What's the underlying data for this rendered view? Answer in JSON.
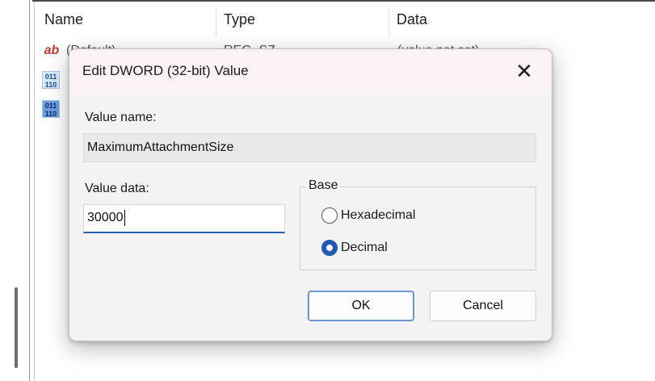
{
  "list": {
    "columns": [
      {
        "label": "Name"
      },
      {
        "label": "Type"
      },
      {
        "label": "Data"
      }
    ],
    "rows": [
      {
        "icon": "string-value-icon",
        "name": "(Default)",
        "type": "REG_SZ",
        "data": "(value not set)"
      },
      {
        "icon": "dword-value-icon",
        "name": "",
        "type": "",
        "data": ""
      },
      {
        "icon": "dword-value-icon-selected",
        "name": "",
        "type": "",
        "data": ""
      }
    ]
  },
  "dialog": {
    "title": "Edit DWORD (32-bit) Value",
    "close_glyph": "✕",
    "value_name_label": "Value name:",
    "value_name": "MaximumAttachmentSize",
    "value_data_label": "Value data:",
    "value_data": "30000",
    "base_label": "Base",
    "base_options": [
      {
        "label": "Hexadecimal",
        "checked": false
      },
      {
        "label": "Decimal",
        "checked": true
      }
    ],
    "ok_label": "OK",
    "cancel_label": "Cancel"
  },
  "icons": {
    "string_glyph": "ab",
    "binary_glyph": "011\n110"
  },
  "colors": {
    "accent": "#1f5bb5",
    "dialog_bg": "#f3f3f3",
    "titlebar_bg": "#fbf3f3"
  }
}
